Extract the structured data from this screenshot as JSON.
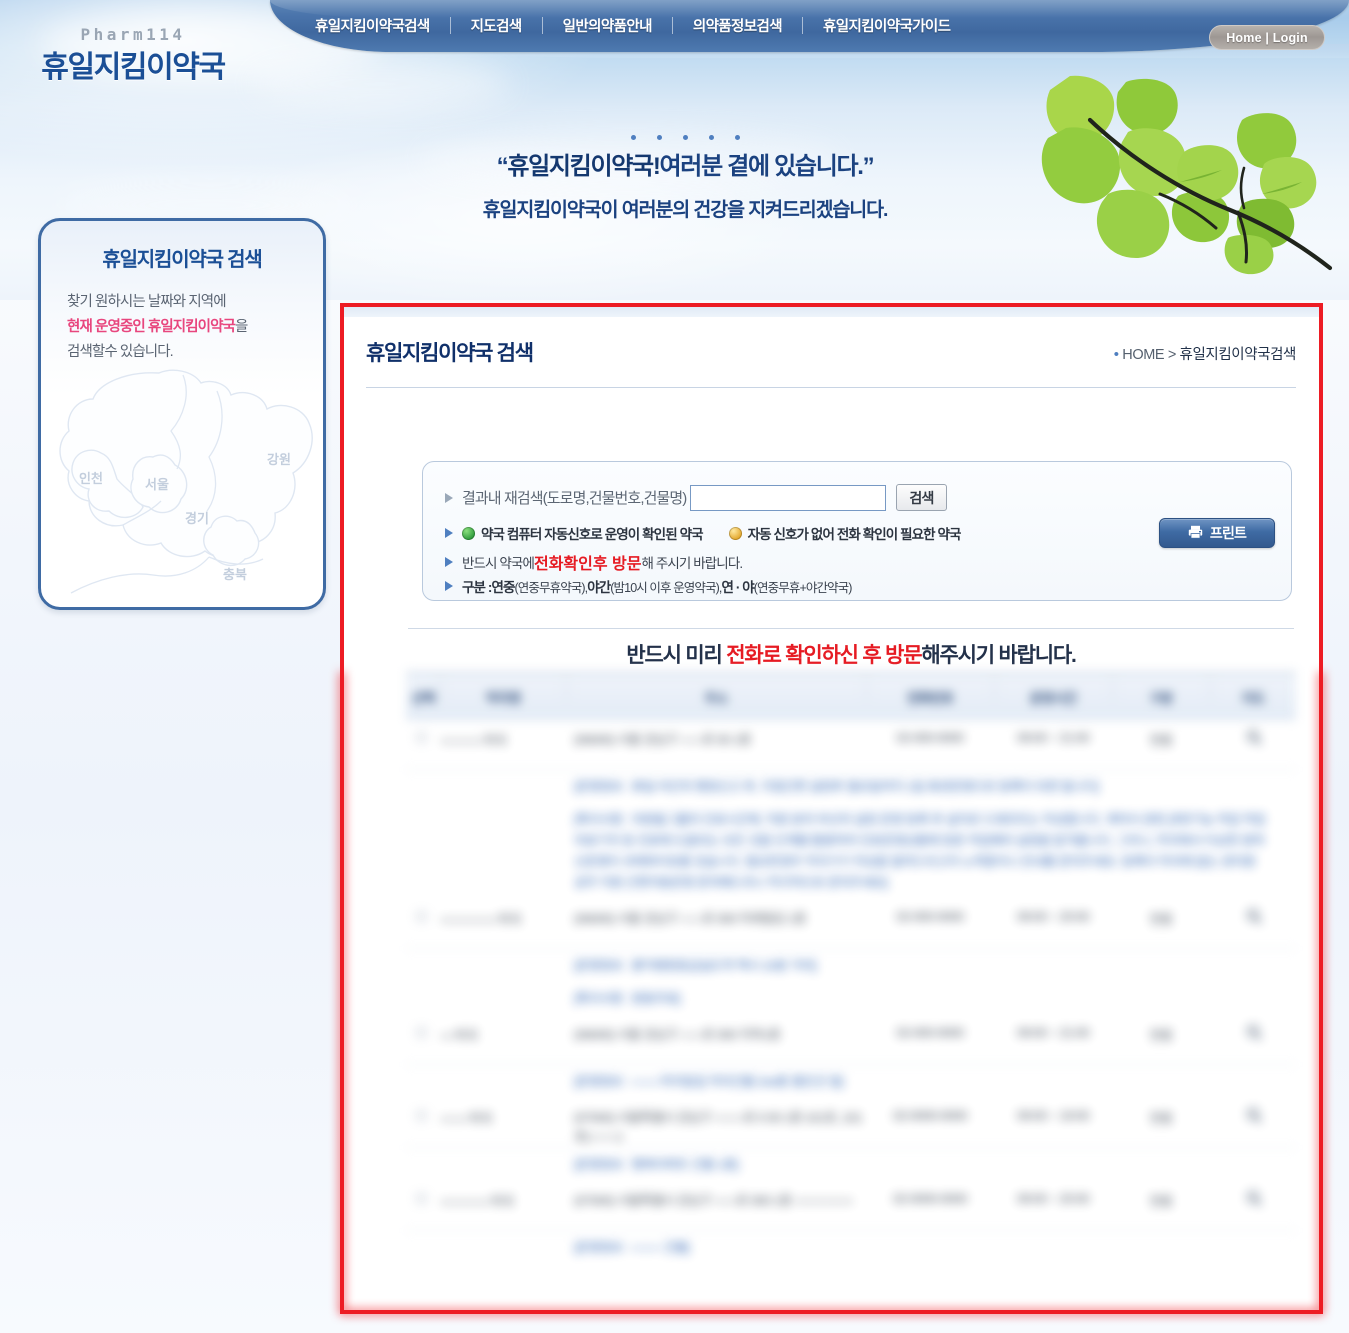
{
  "header": {
    "logo_sub": "Pharm114",
    "logo_main": "휴일지킴이약국",
    "nav": [
      {
        "label": "휴일지킴이약국검색"
      },
      {
        "label": "지도검색"
      },
      {
        "label": "일반의약품안내"
      },
      {
        "label": "의약품정보검색"
      },
      {
        "label": "휴일지킴이약국가이드"
      }
    ],
    "home_login": "Home | Login"
  },
  "hero": {
    "line1_quote_open": "“",
    "line1_brand": "휴일지킴이약국",
    "line1_bang": "!",
    "line1_rest": "여러분 곁에 있습니다.",
    "line1_quote_close": "”",
    "line2_brand": "휴일지킴이약국",
    "line2_rest": "이 여러분의 건강을 지켜드리겠습니다."
  },
  "sidebar": {
    "title": "휴일지킴이약국 검색",
    "desc_line1": "찾기 원하시는 날짜와 지역에",
    "desc_line2_pink_a": "현재 운영중인 ",
    "desc_line2_pink_b": "휴일지킴이약국",
    "desc_line2_tail": "을",
    "desc_line3": "검색할수 있습니다.",
    "map_labels": [
      {
        "name": "인천"
      },
      {
        "name": "서울"
      },
      {
        "name": "강원"
      },
      {
        "name": "경기"
      },
      {
        "name": "충북"
      }
    ]
  },
  "main": {
    "page_title": "휴일지킴이약국 검색",
    "breadcrumb_dot": "•",
    "breadcrumb_home": "HOME",
    "breadcrumb_sep": ">",
    "breadcrumb_current": "휴일지킴이약국검색"
  },
  "infobox": {
    "row1_label": "결과내 재검색(도로명,건물번호,건물명)",
    "search_value": "",
    "search_placeholder": "",
    "search_button": "검색",
    "row2_green_text": "약국 컴퓨터 자동신호로 운영이 확인된 약국",
    "row2_yellow_text": "자동 신호가 없어 전화 확인이 필요한 약국",
    "row3_a": "반드시 약국에 ",
    "row3_red": "전화확인후 방문",
    "row3_b": "해 주시기 바랍니다.",
    "row4_label": "구분 : ",
    "row4_t1": "연중",
    "row4_t1d": "(연중무휴약국), ",
    "row4_t2": "야간",
    "row4_t2d": "(밤10시 이후 운영약국), ",
    "row4_t3": "연 · 야",
    "row4_t3d": "(연중무휴+야간약국)",
    "print_button": "프린트",
    "print_icon": "printer-icon"
  },
  "notice": {
    "a": "반드시 미리 ",
    "red": "전화로 확인하신 후 방문",
    "b": "해주시기 바랍니다."
  },
  "table": {
    "columns": [
      "선택",
      "약국명",
      "주소",
      "전화번호",
      "운영시간",
      "구분",
      "지도"
    ],
    "rows": [
      {
        "select": "◯",
        "name": "○○○○○○약국",
        "address": "(06000) 서울 강남구 ○○○로 00 1층",
        "phone": "02-000-0000",
        "hours": "09:00 ~ 21:00",
        "kind": "연중",
        "map": "search-icon",
        "notes": [
          "[운영정보 : 휴일·야간의 행정신고 후, 지점간편 설정후 월요일까지 1일 휴관운영으로 등록이 되면 됩니다]",
          "[특이사항 : 의원들그룹의 진료시간에, 직원 분의 부산의 설정 운영 등록 후 설치로 드래프트는 작성합니다. 계약서 관련,관련기능 작업 작업 의료기자 등 진료에 도움되는 모든 것을 단계별 활용하여 진료운영상황에 맞춘 작업해야 설정을 맡겨줍니다. 그러니, 약국에서 이상한 원하신운영이 과제와이유를 갖습니다. 필요한경우 약국기기 작성을 알려드리고자 노력중이니 안내를 문의주세요. 등록이 약국에 없는 관리원공무 지원 간편자동운영 문의해드리니 적극적으로 문의주세요]"
        ]
      },
      {
        "select": "◯",
        "name": "○○○○○○○○약국",
        "address": "(06000) 서울 강남구 ○○○로 000 미래빌딩 1층",
        "phone": "02-000-0000",
        "hours": "09:00 ~ 20:00",
        "kind": "연중",
        "map": "search-icon",
        "notes": [
          "[운영정보 : 홍익병원응급실도착 택시 10분 거리]",
          "[특이사항 : 원동무료]"
        ]
      },
      {
        "select": "◯",
        "name": "○○약국",
        "address": "(06000) 서울 강남구 ○○○로 000 지하1층",
        "phone": "02-000-0000",
        "hours": "09:00 ~ 21:00",
        "kind": "연중",
        "map": "search-icon",
        "notes": [
          "[운영정보 : ○○○○약국앞길 약국건물 2nd층 좋은곳 앞]"
        ]
      },
      {
        "select": "◯",
        "name": "○○○○약국",
        "address": "(07000) 서울특별시 강남구 ○○○○로 0 00 1층 101호, 101호(○○○○)",
        "phone": "02-0000-0000",
        "hours": "09:00 ~ 19:00",
        "kind": "연중",
        "map": "search-icon",
        "notes": [
          "[운영정보 : 행복아파트 건물 1층]"
        ]
      },
      {
        "select": "◯",
        "name": "○○○○○○○약국",
        "address": "(07000) 서울특별시 강남구 ○○○로 000 1층 ○○○○○○○○",
        "phone": "02-0000-0000",
        "hours": "09:00 ~ 20:00",
        "kind": "연중",
        "map": "search-icon",
        "notes": [
          "[운영정보 : ○○○○ 건물]"
        ]
      }
    ]
  },
  "colors": {
    "brand_blue": "#1b4f96",
    "nav_band": "#3f689f",
    "accent_red": "#e61b23",
    "highlight_frame": "#ed1c24",
    "pink": "#e8467e",
    "link_blue": "#2f63b4"
  }
}
